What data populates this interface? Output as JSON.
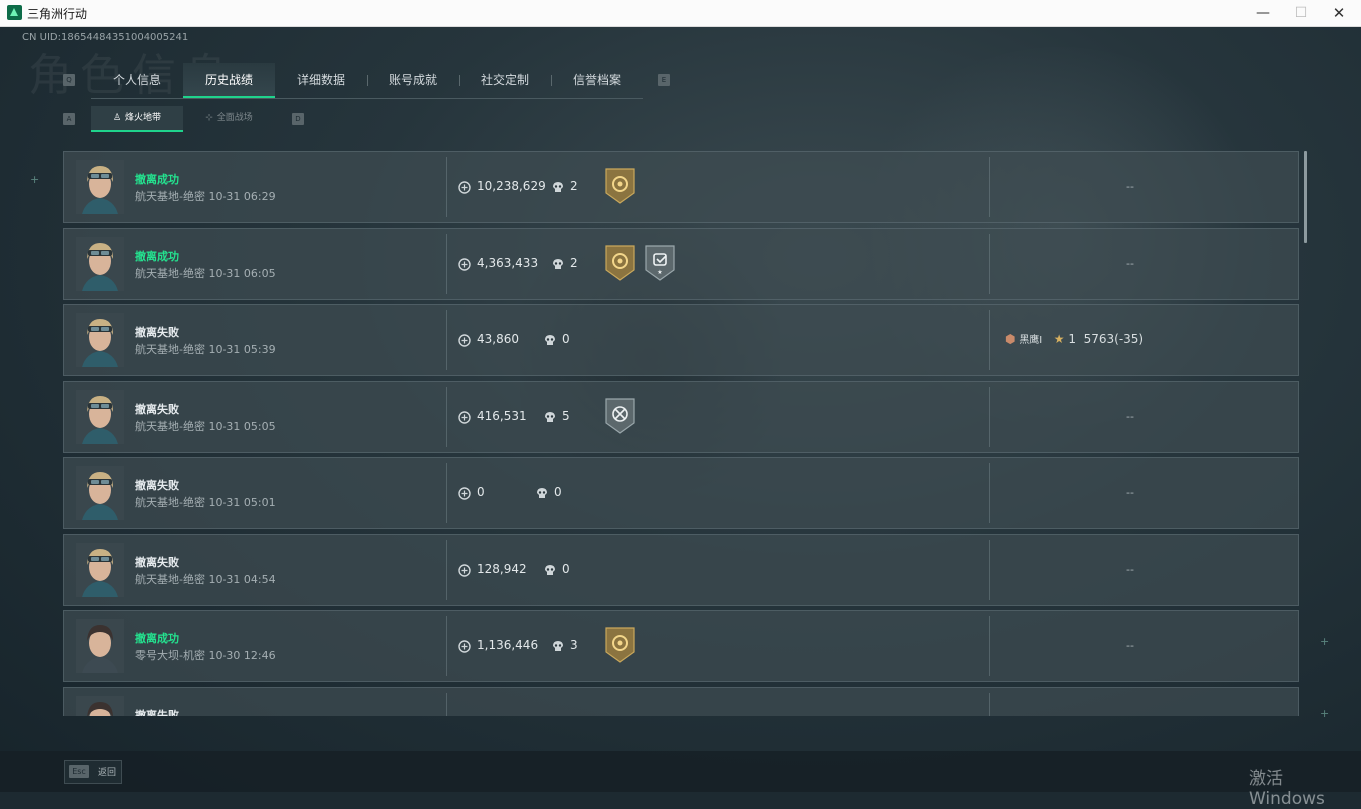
{
  "window": {
    "title": "三角洲行动",
    "minimize": "—",
    "maximize": "☐",
    "close": "✕"
  },
  "header": {
    "uid": "CN UID:1865448435100400524​1",
    "watermark_title": "角色信息"
  },
  "key_hints": {
    "prev_tab": "Q",
    "next_tab": "E",
    "prev_sub": "A",
    "next_sub": "D"
  },
  "tabs": [
    {
      "label": "个人信息",
      "active": false
    },
    {
      "label": "历史战绩",
      "active": true
    },
    {
      "label": "详细数据",
      "active": false
    },
    {
      "label": "账号成就",
      "active": false
    },
    {
      "label": "社交定制",
      "active": false
    },
    {
      "label": "信誉档案",
      "active": false
    }
  ],
  "subtabs": [
    {
      "label": "烽火地带",
      "icon": "♙",
      "active": true
    },
    {
      "label": "全面战场",
      "icon": "⊹",
      "active": false
    }
  ],
  "matches": [
    {
      "status": "撤离成功",
      "result": "win",
      "map": "航天基地-绝密 10-31 06:29",
      "value": "10,238,629",
      "kills": "2",
      "badges": [
        "gold"
      ],
      "extra": "--",
      "avatar": "blonde"
    },
    {
      "status": "撤离成功",
      "result": "win",
      "map": "航天基地-绝密 10-31 06:05",
      "value": "4,363,433",
      "kills": "2",
      "badges": [
        "gold",
        "silver-check"
      ],
      "extra": "--",
      "avatar": "blonde"
    },
    {
      "status": "撤离失败",
      "result": "lose",
      "map": "航天基地-绝密 10-31 05:39",
      "value": "43,860",
      "kills": "0",
      "badges": [],
      "extra": "",
      "rank_name": "黑鹰I",
      "rank_stars": "1",
      "rank_score": "5763(-35)",
      "avatar": "blonde"
    },
    {
      "status": "撤离失败",
      "result": "lose",
      "map": "航天基地-绝密 10-31 05:05",
      "value": "416,531",
      "kills": "5",
      "badges": [
        "silver-cross"
      ],
      "extra": "--",
      "avatar": "blonde"
    },
    {
      "status": "撤离失败",
      "result": "lose",
      "map": "航天基地-绝密 10-31 05:01",
      "value": "0",
      "kills": "0",
      "badges": [],
      "extra": "--",
      "avatar": "blonde"
    },
    {
      "status": "撤离失败",
      "result": "lose",
      "map": "航天基地-绝密 10-31 04:54",
      "value": "128,942",
      "kills": "0",
      "badges": [],
      "extra": "--",
      "avatar": "blonde"
    },
    {
      "status": "撤离成功",
      "result": "win",
      "map": "零号大坝-机密 10-30 12:46",
      "value": "1,136,446",
      "kills": "3",
      "badges": [
        "gold"
      ],
      "extra": "--",
      "avatar": "dark"
    },
    {
      "status": "撤离失败",
      "result": "lose",
      "map": "",
      "value": "",
      "kills": "",
      "badges": [],
      "extra": "",
      "avatar": "dark"
    }
  ],
  "footer": {
    "esc_key": "Esc",
    "esc_label": "返回"
  },
  "os_watermark": "激活 Windows",
  "colors": {
    "accent": "#1fd38c",
    "win": "#24e28f",
    "gold_badge": "#8b7440",
    "silver_badge": "#5c686c"
  }
}
